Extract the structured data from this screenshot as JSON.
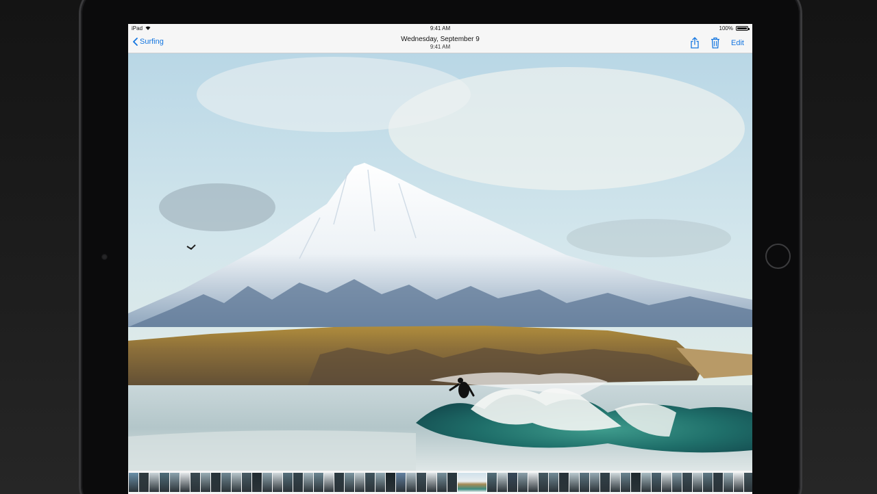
{
  "status_bar": {
    "device": "iPad",
    "time": "9:41 AM",
    "battery": "100%"
  },
  "nav_bar": {
    "back_label": "Surfing",
    "title": "Wednesday, September 9",
    "subtitle": "9:41 AM",
    "edit_label": "Edit"
  },
  "icons": {
    "back": "chevron-left-icon",
    "share": "share-icon",
    "delete": "trash-icon",
    "wifi": "wifi-icon",
    "battery": "battery-icon"
  },
  "colors": {
    "tint": "#1476e0",
    "bar_background": "#f6f6f6"
  },
  "filmstrip": {
    "thumbnails": [
      "#6a8fa8",
      "#2f3a3f",
      "#c9d3d8",
      "#4f6d7a",
      "#8aa2ad",
      "#e3e7ea",
      "#3a4a52",
      "#98acb4",
      "#27343a",
      "#6f8793",
      "#b7c5cb",
      "#4a5d66",
      "#1f2a30",
      "#8ea4ae",
      "#d2dade",
      "#56707c",
      "#33444c",
      "#a5b8c0",
      "#6b8591",
      "#e0e6e9",
      "#2c3b42",
      "#7d96a1",
      "#c2ced3",
      "#40545d",
      "#91a8b2",
      "#1a2429",
      "#6280a0",
      "#b0c0c8",
      "#3e5059",
      "#dfe5e8",
      "#77909c",
      "#2a3840",
      "#a0b4bd",
      "#55707b",
      "#c8d4d9",
      "#38495a",
      "#8ba0aa",
      "#e5e9ec",
      "#465a63",
      "#728b97",
      "#273239",
      "#b8c7cd",
      "#5c7682",
      "#94a9b3",
      "#32424a",
      "#cfd9dd",
      "#6a8490",
      "#1e292f",
      "#a9bcc4",
      "#4d6571",
      "#d9e1e4",
      "#7e97a3",
      "#3b4d56",
      "#c0cdd2",
      "#5f7985",
      "#2e3c44",
      "#99afb8",
      "#e8ecee",
      "#44575f",
      "#86a0ab",
      "#253037",
      "#b4c3c9",
      "#587280"
    ],
    "selected_index": 32
  }
}
